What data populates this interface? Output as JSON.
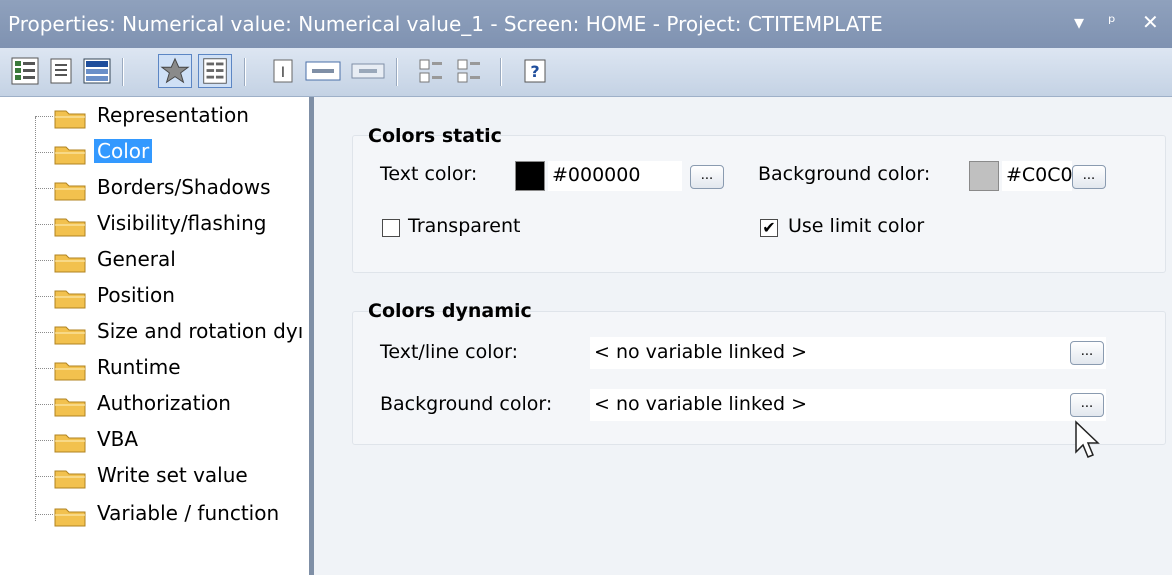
{
  "window": {
    "title": "Properties: Numerical value: Numerical value_1 - Screen: HOME - Project: CTITEMPLATE",
    "controls": [
      "▾",
      "ᵖ",
      "✕"
    ]
  },
  "toolbar": {
    "icons": [
      "tree-view-icon",
      "document-icon",
      "list-view-icon",
      "favorites-icon",
      "grid-view-icon",
      "text-icon",
      "input-icon",
      "output-icon",
      "expand-icon",
      "collapse-icon",
      "help-icon"
    ]
  },
  "tree": {
    "items": [
      {
        "label": "Representation"
      },
      {
        "label": "Color"
      },
      {
        "label": "Borders/Shadows"
      },
      {
        "label": "Visibility/flashing"
      },
      {
        "label": "General"
      },
      {
        "label": "Position"
      },
      {
        "label": "Size and rotation dyı"
      },
      {
        "label": "Runtime"
      },
      {
        "label": "Authorization"
      },
      {
        "label": "VBA"
      },
      {
        "label": "Write set value"
      },
      {
        "label": "Variable / function"
      }
    ],
    "selected": "Color"
  },
  "colors_static": {
    "title": "Colors static",
    "text_color_label": "Text color:",
    "text_color_value": "#000000",
    "text_color_swatch": "#000000",
    "bg_color_label": "Background color:",
    "bg_color_value": "#C0C0",
    "bg_color_swatch": "#c0c0c0",
    "transparent_label": "Transparent",
    "transparent_checked": false,
    "use_limit_label": "Use limit color",
    "use_limit_checked": true,
    "button_label": "..."
  },
  "colors_dynamic": {
    "title": "Colors dynamic",
    "text_line_label": "Text/line color:",
    "text_line_value": "< no variable linked >",
    "bg_label": "Background color:",
    "bg_value": "< no variable linked >",
    "button_label": "..."
  },
  "theme": {
    "title_bar": "#8596b5",
    "selection": "#3399ff",
    "folder": "#f2c14e"
  }
}
